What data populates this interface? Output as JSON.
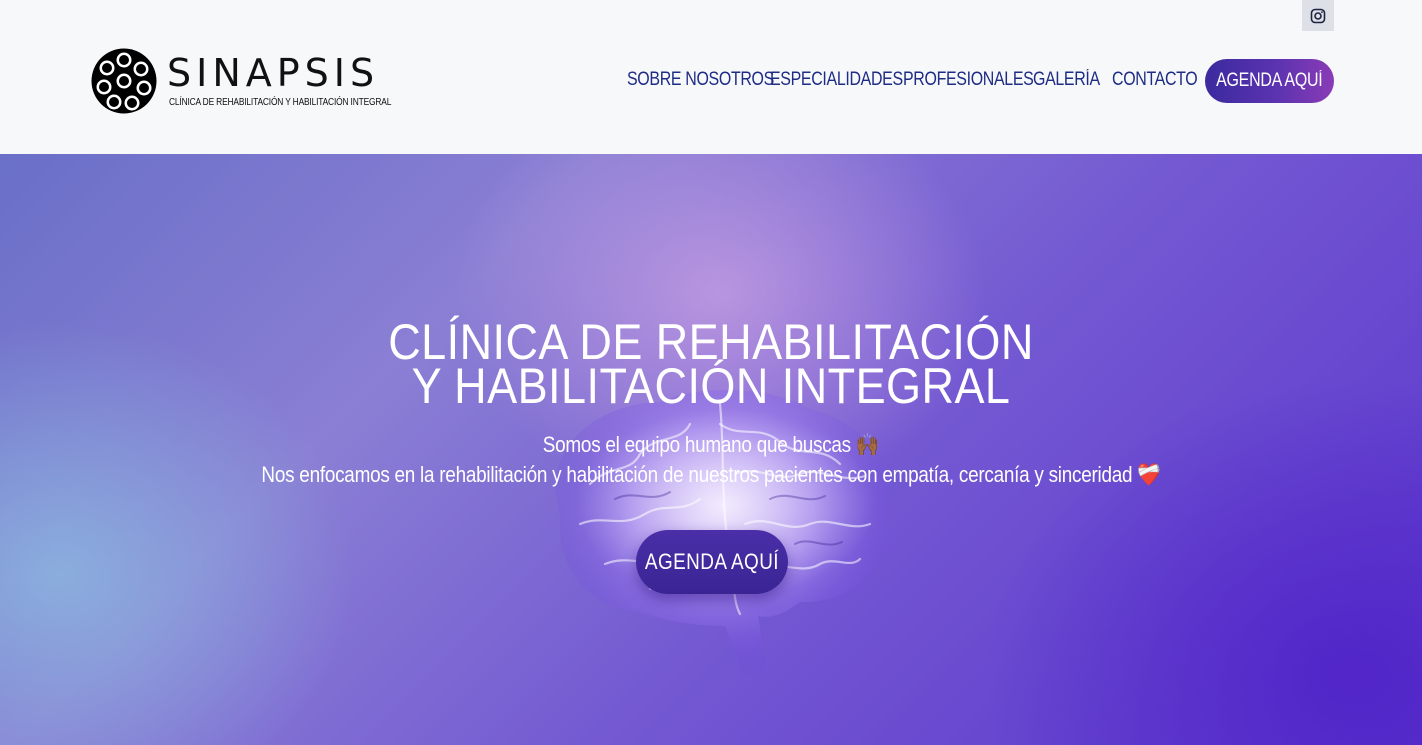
{
  "header": {
    "logo": {
      "word": "SINAPSIS",
      "tagline": "CLÍNICA DE REHABILITACIÓN Y HABILITACIÓN INTEGRAL"
    },
    "social_icon": "instagram-icon",
    "nav": [
      {
        "label": "SOBRE NOSOTROS"
      },
      {
        "label": "ESPECIALIDADES"
      },
      {
        "label": "PROFESIONALES"
      },
      {
        "label": "GALERÍA"
      },
      {
        "label": "CONTACTO"
      }
    ],
    "cta_label": "AGENDA AQUÍ"
  },
  "hero": {
    "title_line1": "CLÍNICA DE REHABILITACIÓN",
    "title_line2": "Y HABILITACIÓN INTEGRAL",
    "subtitle_line1": "Somos el equipo humano que buscas",
    "subtitle_line1_emoji": "🙌🏾",
    "subtitle_line2": "Nos enfocamos en la rehabilitación y habilitación de nuestros pacientes con empatía, cercanía y sinceridad",
    "subtitle_line2_emoji": "❤️‍🩹",
    "cta_label": "AGENDA AQUÍ",
    "background_image": "brain-illustration"
  },
  "colors": {
    "nav_text": "#1e2c86",
    "cta_gradient_start": "#3b2a9e",
    "cta_gradient_end": "#8a3bb6",
    "header_bg": "#f7f8fa"
  }
}
